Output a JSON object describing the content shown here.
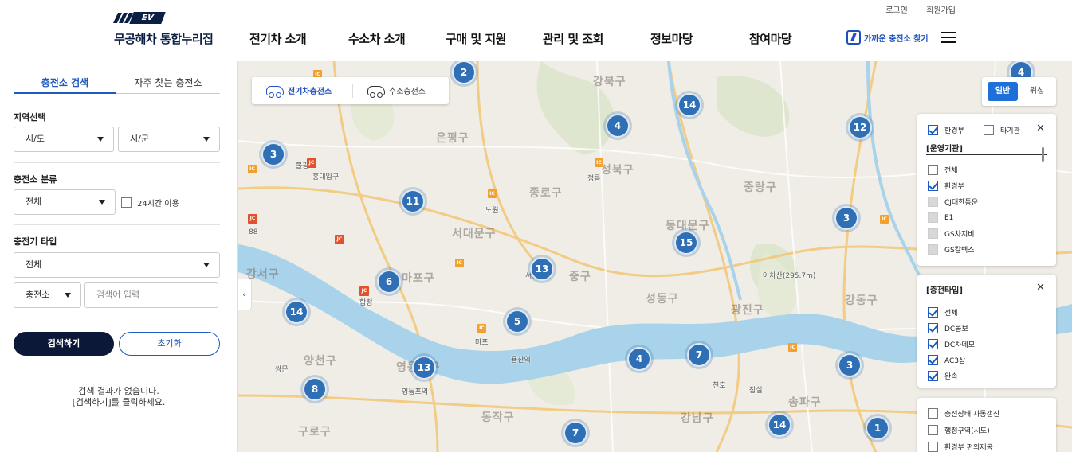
{
  "header": {
    "util": {
      "login": "로그인",
      "signup": "회원가입"
    },
    "logo": {
      "badge": "EV",
      "title": "무공해차 통합누리집"
    },
    "nav": [
      "전기차 소개",
      "수소차 소개",
      "구매 및 지원",
      "관리 및 조회",
      "정보마당",
      "참여마당"
    ],
    "nearby_label": "가까운 충전소 찾기",
    "menu_icon": "hamburger-icon"
  },
  "sidebar": {
    "tabs": [
      "충전소 검색",
      "자주 찾는 충전소"
    ],
    "region": {
      "label": "지역선택",
      "sido": "시/도",
      "sigun": "시/군"
    },
    "category": {
      "label": "충전소 분류",
      "value": "전체",
      "check24": "24시간 이용"
    },
    "charger_type": {
      "label": "충전기 타입",
      "value": "전체"
    },
    "search": {
      "scope": "충전소",
      "placeholder": "검색어 입력"
    },
    "buttons": {
      "search": "검색하기",
      "reset": "초기화"
    },
    "no_result": [
      "검색 결과가 없습니다.",
      "[검색하기]를 클릭하세요."
    ],
    "collapse_icon": "chevron-left-icon"
  },
  "map": {
    "type_tabs": [
      "전기차충전소",
      "수소충전소"
    ],
    "map_type": {
      "normal": "일반",
      "satellite": "위성"
    },
    "districts": [
      "은평구",
      "성북구",
      "종로구",
      "서대문구",
      "중랑구",
      "마포구",
      "동대문구",
      "중구",
      "성동구",
      "광진구",
      "강동구",
      "강서구",
      "영등포구",
      "동작구",
      "강남구",
      "송파구",
      "양천구",
      "구로구",
      "강북구"
    ],
    "clusters": [
      2,
      4,
      14,
      4,
      12,
      3,
      11,
      3,
      15,
      6,
      13,
      14,
      5,
      4,
      7,
      3,
      13,
      8,
      7,
      14,
      1
    ],
    "pois": [
      "홍대입구",
      "합정",
      "마포",
      "용산역",
      "영등포역",
      "정릉",
      "서울시청",
      "아차산(295.7m)",
      "노원",
      "불광",
      "88",
      "쌍문",
      "천호",
      "잠실"
    ],
    "operator_panel": {
      "filters": [
        {
          "label": "환경부",
          "checked": true
        },
        {
          "label": "타기관",
          "checked": false
        }
      ],
      "title": "[운영기관]",
      "items": [
        {
          "label": "전체",
          "checked": false
        },
        {
          "label": "환경부",
          "checked": true
        },
        {
          "label": "CJ대한통운",
          "checked": false
        },
        {
          "label": "E1",
          "checked": false
        },
        {
          "label": "GS차지비",
          "checked": false
        },
        {
          "label": "GS칼텍스",
          "checked": false
        }
      ]
    },
    "charger_panel": {
      "title": "[충전타입]",
      "items": [
        {
          "label": "전체",
          "checked": true
        },
        {
          "label": "DC콤보",
          "checked": true
        },
        {
          "label": "DC차데모",
          "checked": true
        },
        {
          "label": "AC3상",
          "checked": true
        },
        {
          "label": "완속",
          "checked": true
        }
      ]
    },
    "options_panel": {
      "items": [
        {
          "label": "충전상태 자동갱신",
          "checked": false
        },
        {
          "label": "행정구역(시도)",
          "checked": false
        },
        {
          "label": "환경부 편의제공",
          "checked": false
        }
      ]
    },
    "colors": {
      "cluster": "#2f6fb5",
      "river": "#9ecbe6",
      "accent": "#1e5bbf",
      "primary_button": "#0b1838"
    }
  }
}
